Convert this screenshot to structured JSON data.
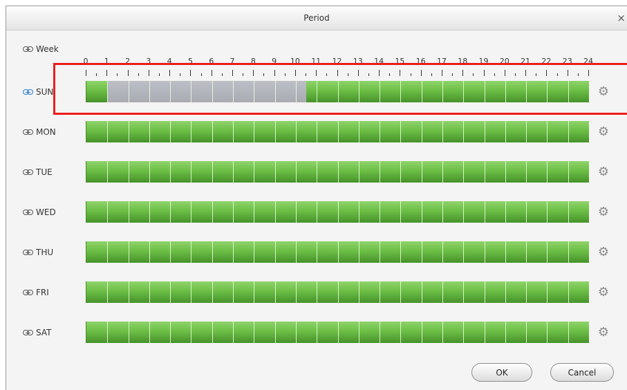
{
  "dialog": {
    "title": "Period",
    "close_glyph": "×"
  },
  "week": {
    "label": "Week",
    "icon": "link-icon"
  },
  "ruler": {
    "hours": [
      "0",
      "1",
      "2",
      "3",
      "4",
      "5",
      "6",
      "7",
      "8",
      "9",
      "10",
      "11",
      "12",
      "13",
      "14",
      "15",
      "16",
      "17",
      "18",
      "19",
      "20",
      "21",
      "22",
      "23",
      "24"
    ]
  },
  "days": [
    {
      "label": "SUN",
      "active": true,
      "enabled_ranges": [
        [
          0,
          1
        ],
        [
          10.5,
          24
        ]
      ]
    },
    {
      "label": "MON",
      "active": false,
      "enabled_ranges": [
        [
          0,
          24
        ]
      ]
    },
    {
      "label": "TUE",
      "active": false,
      "enabled_ranges": [
        [
          0,
          24
        ]
      ]
    },
    {
      "label": "WED",
      "active": false,
      "enabled_ranges": [
        [
          0,
          24
        ]
      ]
    },
    {
      "label": "THU",
      "active": false,
      "enabled_ranges": [
        [
          0,
          24
        ]
      ]
    },
    {
      "label": "FRI",
      "active": false,
      "enabled_ranges": [
        [
          0,
          24
        ]
      ]
    },
    {
      "label": "SAT",
      "active": false,
      "enabled_ranges": [
        [
          0,
          24
        ]
      ]
    }
  ],
  "colors": {
    "enabled": "#6cbe46",
    "disabled": "#b3b5bc",
    "link_active": "#2a7fd4",
    "link_inactive": "#555555",
    "highlight": "#ec1c1c"
  },
  "buttons": {
    "ok": "OK",
    "cancel": "Cancel"
  }
}
